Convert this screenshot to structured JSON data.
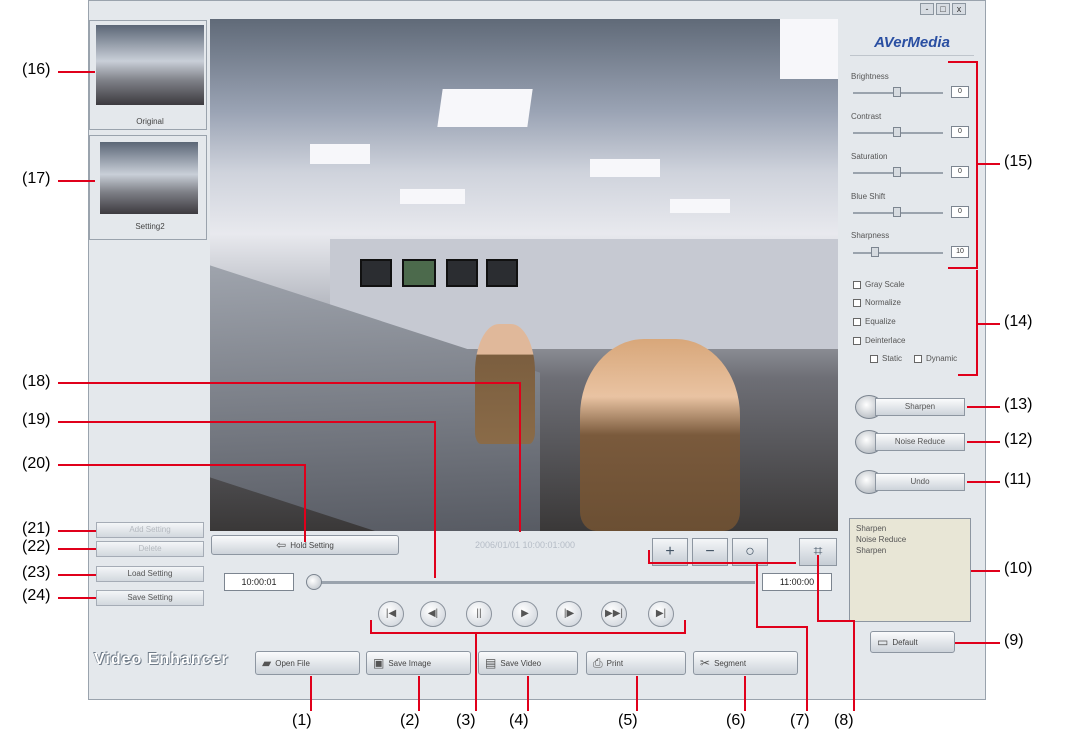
{
  "window_controls": [
    "-",
    "□",
    "x"
  ],
  "brand": "AVerMedia",
  "app_title": "Video Enhancer",
  "thumbnails": [
    {
      "label": "Original"
    },
    {
      "label": "Setting2"
    }
  ],
  "side_buttons": [
    {
      "label": "Add Setting",
      "disabled": true
    },
    {
      "label": "Delete",
      "disabled": true
    },
    {
      "label": "Load Setting",
      "disabled": false
    },
    {
      "label": "Save Setting",
      "disabled": false
    }
  ],
  "hold_setting_label": "Hold Setting",
  "timestamp": "2006/01/01  10:00:01:000",
  "timeline": {
    "start": "10:00:01",
    "end": "11:00:00"
  },
  "playback_controls": [
    "|◀",
    "◀|",
    "||",
    "▶",
    "|▶",
    "▶▶|",
    "▶|"
  ],
  "zoom_buttons": [
    "+",
    "−",
    "○"
  ],
  "sliders": [
    {
      "label": "Brightness",
      "value": "0"
    },
    {
      "label": "Contrast",
      "value": "0"
    },
    {
      "label": "Saturation",
      "value": "0"
    },
    {
      "label": "Blue Shift",
      "value": "0"
    },
    {
      "label": "Sharpness",
      "value": "10"
    }
  ],
  "checkboxes": [
    {
      "label": "Gray Scale"
    },
    {
      "label": "Normalize"
    },
    {
      "label": "Equalize"
    },
    {
      "label": "Deinterlace"
    }
  ],
  "deinterlace_options": [
    "Static",
    "Dynamic"
  ],
  "action_buttons": [
    {
      "label": "Sharpen"
    },
    {
      "label": "Noise Reduce"
    },
    {
      "label": "Undo"
    }
  ],
  "history": [
    "Sharpen",
    "Noise Reduce",
    "Sharpen"
  ],
  "default_button": "Default",
  "toolbar": [
    {
      "label": "Open File",
      "icon": "folder-icon"
    },
    {
      "label": "Save Image",
      "icon": "image-icon"
    },
    {
      "label": "Save Video",
      "icon": "film-icon"
    },
    {
      "label": "Print",
      "icon": "printer-icon"
    },
    {
      "label": "Segment",
      "icon": "scissors-icon"
    }
  ],
  "callouts": [
    "(1)",
    "(2)",
    "(3)",
    "(4)",
    "(5)",
    "(6)",
    "(7)",
    "(8)",
    "(9)",
    "(10)",
    "(11)",
    "(12)",
    "(13)",
    "(14)",
    "(15)",
    "(16)",
    "(17)",
    "(18)",
    "(19)",
    "(20)",
    "(21)",
    "(22)",
    "(23)",
    "(24)"
  ],
  "accent_color": "#e0001b"
}
